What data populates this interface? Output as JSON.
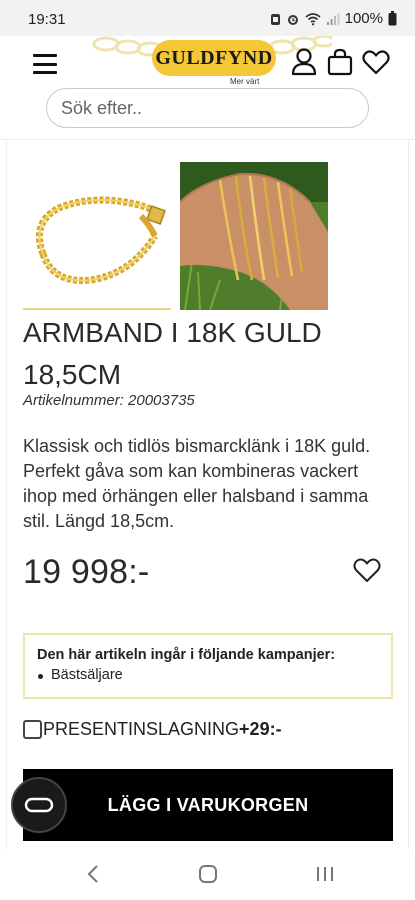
{
  "status_bar": {
    "time": "19:31",
    "battery": "100%",
    "icons": [
      "notification-icon",
      "alarm-icon",
      "wifi-icon",
      "signal-icon",
      "battery-icon"
    ]
  },
  "header": {
    "logo_text": "GULDFYND",
    "logo_tagline": "Mer värt",
    "search_placeholder": "Sök efter..",
    "icons": [
      "menu-icon",
      "user-icon",
      "cart-icon",
      "heart-icon"
    ]
  },
  "product": {
    "title": "ARMBAND I 18K GULD 18,5CM",
    "article_label": "Artikelnummer:",
    "article_number": "20003735",
    "description": "Klassisk och tidlös bismarcklänk i 18K guld. Perfekt gåva som kan kombineras vackert ihop med örhängen eller halsband i samma stil. Längd 18,5cm.",
    "price": "19 998:-"
  },
  "campaign": {
    "title": "Den här artikeln ingår i följande kampanjer:",
    "items": [
      "Bästsäljare"
    ]
  },
  "gift_wrap": {
    "label": "PRESENTINSLAGNING",
    "price": "+29:-",
    "checked": false
  },
  "add_to_cart_label": "LÄGG I VARUKORGEN",
  "colors": {
    "brand_gold": "#f3c736",
    "campaign_border": "#ece6a8",
    "button_bg": "#000000"
  }
}
